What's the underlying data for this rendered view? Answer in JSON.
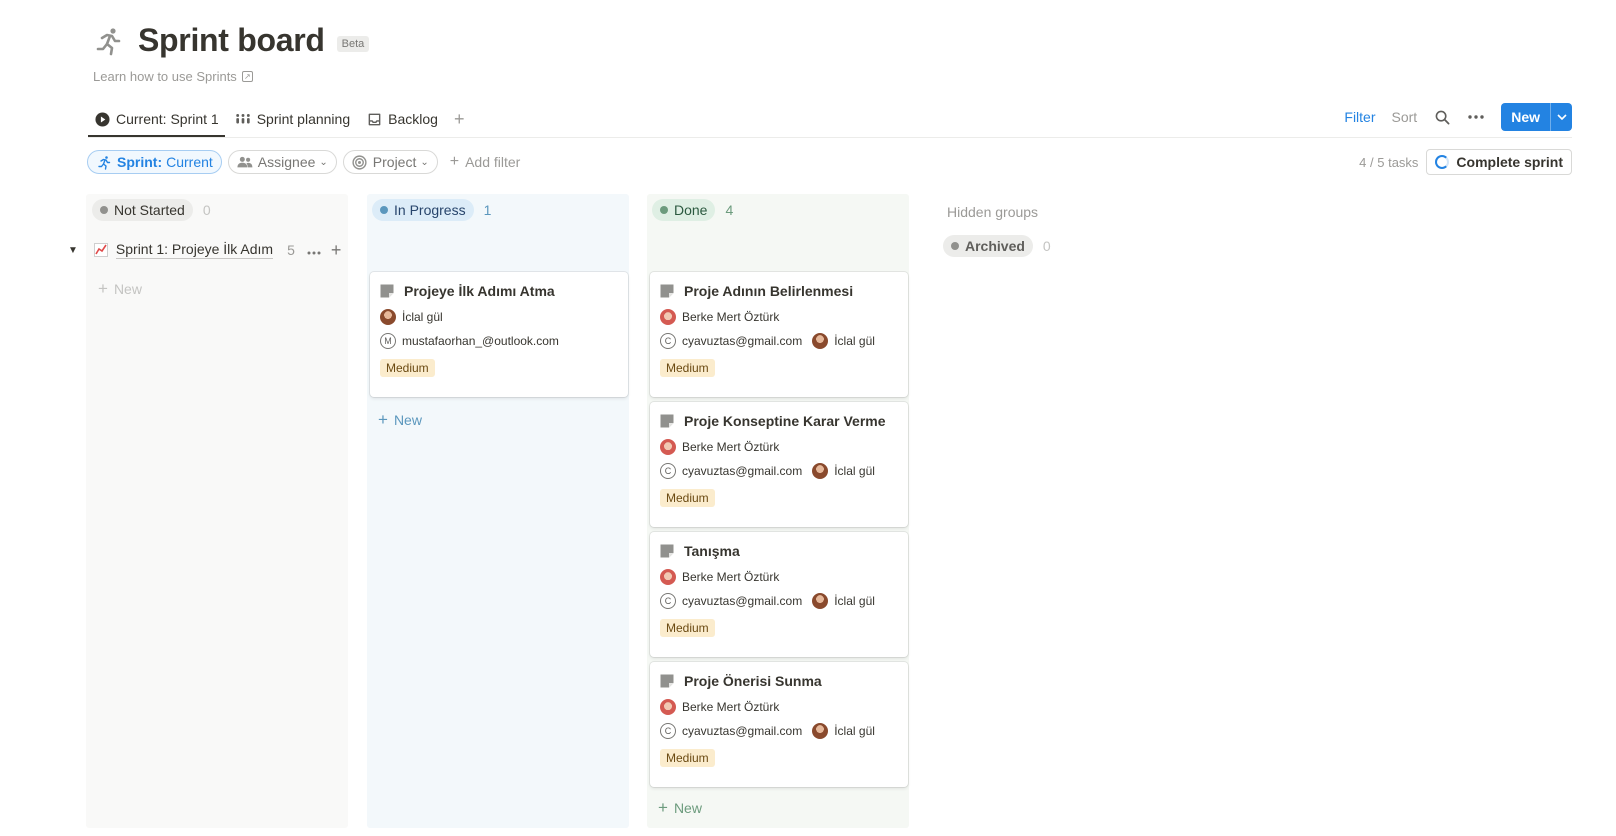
{
  "page": {
    "title": "Sprint board",
    "beta_label": "Beta",
    "learn_link": "Learn how to use Sprints"
  },
  "tabs": [
    {
      "label": "Current: Sprint 1",
      "icon": "play-circle-icon",
      "active": true
    },
    {
      "label": "Sprint planning",
      "icon": "timeline-icon",
      "active": false
    },
    {
      "label": "Backlog",
      "icon": "inbox-icon",
      "active": false
    }
  ],
  "toolbar": {
    "filter_label": "Filter",
    "sort_label": "Sort",
    "new_label": "New",
    "accent_color": "#2383e2"
  },
  "filters": {
    "sprint_chip_prefix": "Sprint:",
    "sprint_chip_value": "Current",
    "assignee_label": "Assignee",
    "project_label": "Project",
    "add_filter_label": "Add filter"
  },
  "summary": {
    "task_count": "4 / 5 tasks",
    "complete_label": "Complete sprint"
  },
  "columns": {
    "not_started": {
      "label": "Not Started",
      "count": "0",
      "new_label": "New"
    },
    "in_progress": {
      "label": "In Progress",
      "count": "1",
      "new_label": "New"
    },
    "done": {
      "label": "Done",
      "count": "4",
      "new_label": "New"
    }
  },
  "hidden": {
    "label": "Hidden groups",
    "archived_label": "Archived",
    "archived_count": "0"
  },
  "group": {
    "title": "Sprint 1: Projeye İlk Adım",
    "count": "5"
  },
  "cards": {
    "ip0": {
      "title": "Projeye İlk Adımı Atma",
      "assignee": "İclal gül",
      "reviewer_initial": "M",
      "reviewer": "mustafaorhan_@outlook.com",
      "priority": "Medium"
    },
    "d0": {
      "title": "Proje Adının Belirlenmesi",
      "assignee": "Berke Mert Öztürk",
      "reviewer_initial": "C",
      "reviewer": "cyavuztas@gmail.com",
      "second": "İclal gül",
      "priority": "Medium"
    },
    "d1": {
      "title": "Proje Konseptine Karar Verme",
      "assignee": "Berke Mert Öztürk",
      "reviewer_initial": "C",
      "reviewer": "cyavuztas@gmail.com",
      "second": "İclal gül",
      "priority": "Medium"
    },
    "d2": {
      "title": "Tanışma",
      "assignee": "Berke Mert Öztürk",
      "reviewer_initial": "C",
      "reviewer": "cyavuztas@gmail.com",
      "second": "İclal gül",
      "priority": "Medium"
    },
    "d3": {
      "title": "Proje Önerisi Sunma",
      "assignee": "Berke Mert Öztürk",
      "reviewer_initial": "C",
      "reviewer": "cyavuztas@gmail.com",
      "second": "İclal gül",
      "priority": "Medium"
    }
  }
}
